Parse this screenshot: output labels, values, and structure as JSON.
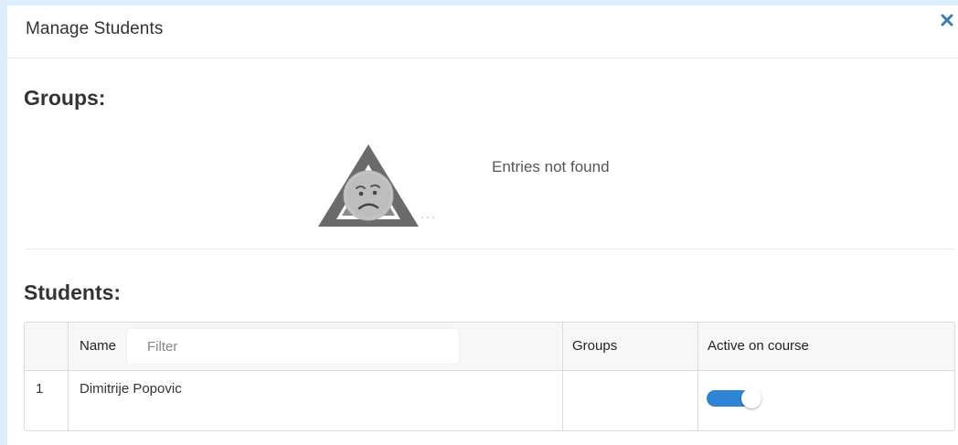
{
  "modal": {
    "title": "Manage Students",
    "close_icon": "close-icon"
  },
  "groups": {
    "title": "Groups:",
    "empty_icon": "sad-face-warning-icon",
    "empty_text": "Entries not found"
  },
  "students": {
    "title": "Students:",
    "columns": {
      "name": "Name",
      "groups": "Groups",
      "active": "Active on course"
    },
    "filter": {
      "placeholder": "Filter",
      "value": ""
    },
    "rows": [
      {
        "number": "1",
        "name": "Dimitrije Popovic",
        "groups": "",
        "active": true
      }
    ]
  },
  "colors": {
    "toggle_on": "#2d85d4",
    "close_icon": "#3c7bb5",
    "background": "#ddeefa"
  }
}
